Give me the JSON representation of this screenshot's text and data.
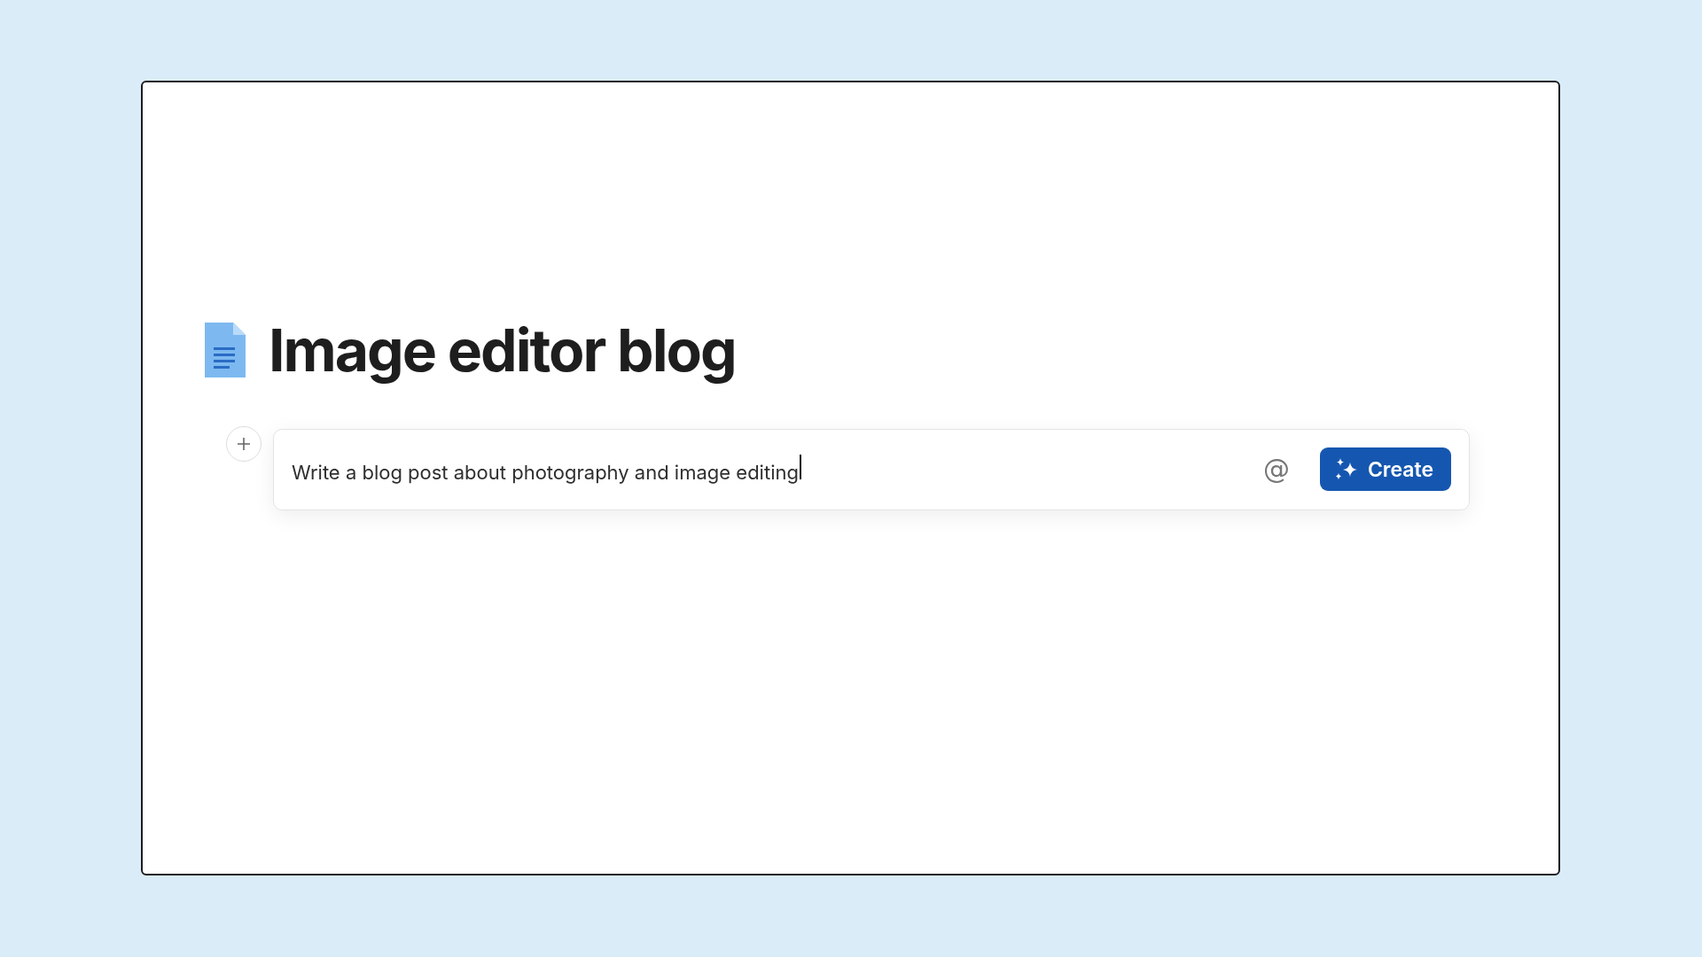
{
  "document": {
    "title": "Image editor blog"
  },
  "prompt": {
    "value": "Write a blog post about photography and image editing",
    "mention_button": "@",
    "create_button": "Create"
  }
}
